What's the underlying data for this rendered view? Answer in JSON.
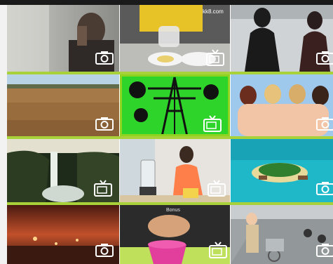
{
  "gallery": {
    "rows": [
      {
        "tiles": [
          {
            "name": "tile-foggy-portrait",
            "type": "camera-icon"
          },
          {
            "name": "tile-glass-water",
            "type": "tv-icon",
            "watermark": "kk8.com"
          },
          {
            "name": "tile-street-silhouettes",
            "type": "camera-icon"
          }
        ]
      },
      {
        "tiles": [
          {
            "name": "tile-dry-field",
            "type": "camera-icon"
          },
          {
            "name": "tile-green-pylon",
            "type": "tv-icon"
          },
          {
            "name": "tile-beach-group",
            "type": "camera-icon"
          }
        ]
      },
      {
        "tiles": [
          {
            "name": "tile-waterfall",
            "type": "tv-icon"
          },
          {
            "name": "tile-blender-kitchen",
            "type": "tv-icon"
          },
          {
            "name": "tile-tropical-island",
            "type": "camera-icon"
          }
        ]
      },
      {
        "tiles": [
          {
            "name": "tile-city-sunset",
            "type": "camera-icon"
          },
          {
            "name": "tile-crafting-hands",
            "type": "tv-icon",
            "caption": "Bonus"
          },
          {
            "name": "tile-cyclists-street",
            "type": "camera-icon"
          }
        ]
      }
    ],
    "accent_color": "#a9d23a"
  }
}
